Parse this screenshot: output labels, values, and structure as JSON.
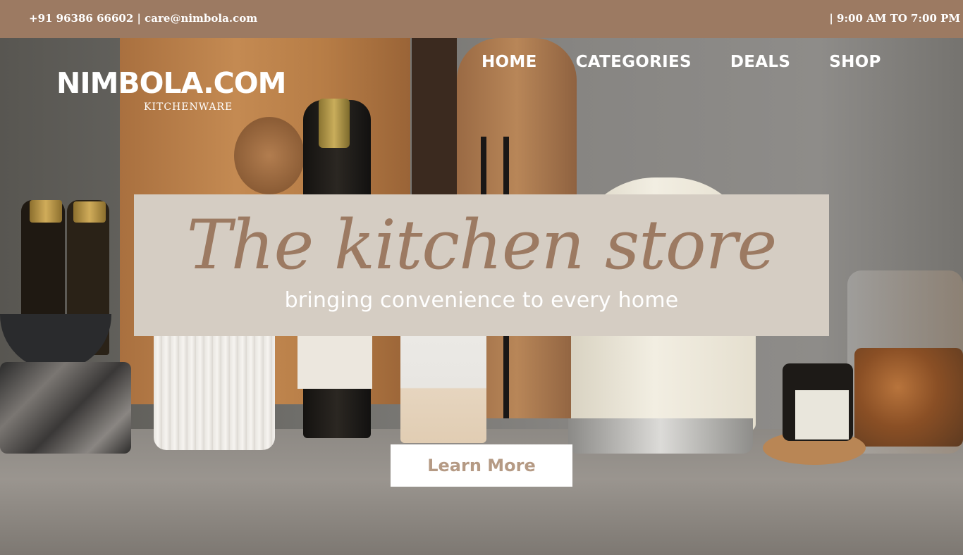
{
  "topbar": {
    "contact": "+91 96386 66602 | care@nimbola.com",
    "hours": "| 9:00 AM TO 7:00 PM"
  },
  "logo": {
    "name": "NIMBOLA.COM",
    "tagline": "KITCHENWARE"
  },
  "nav": {
    "items": [
      "HOME",
      "CATEGORIES",
      "DEALS",
      "SHOP"
    ]
  },
  "hero": {
    "title": "The kitchen store",
    "subtitle": "bringing convenience to every home",
    "cta_label": "Learn More"
  },
  "colors": {
    "accent": "#9c7a62",
    "banner_bg": "#d5cdc3",
    "text_light": "#ffffff",
    "cta_text": "#b59a84"
  }
}
